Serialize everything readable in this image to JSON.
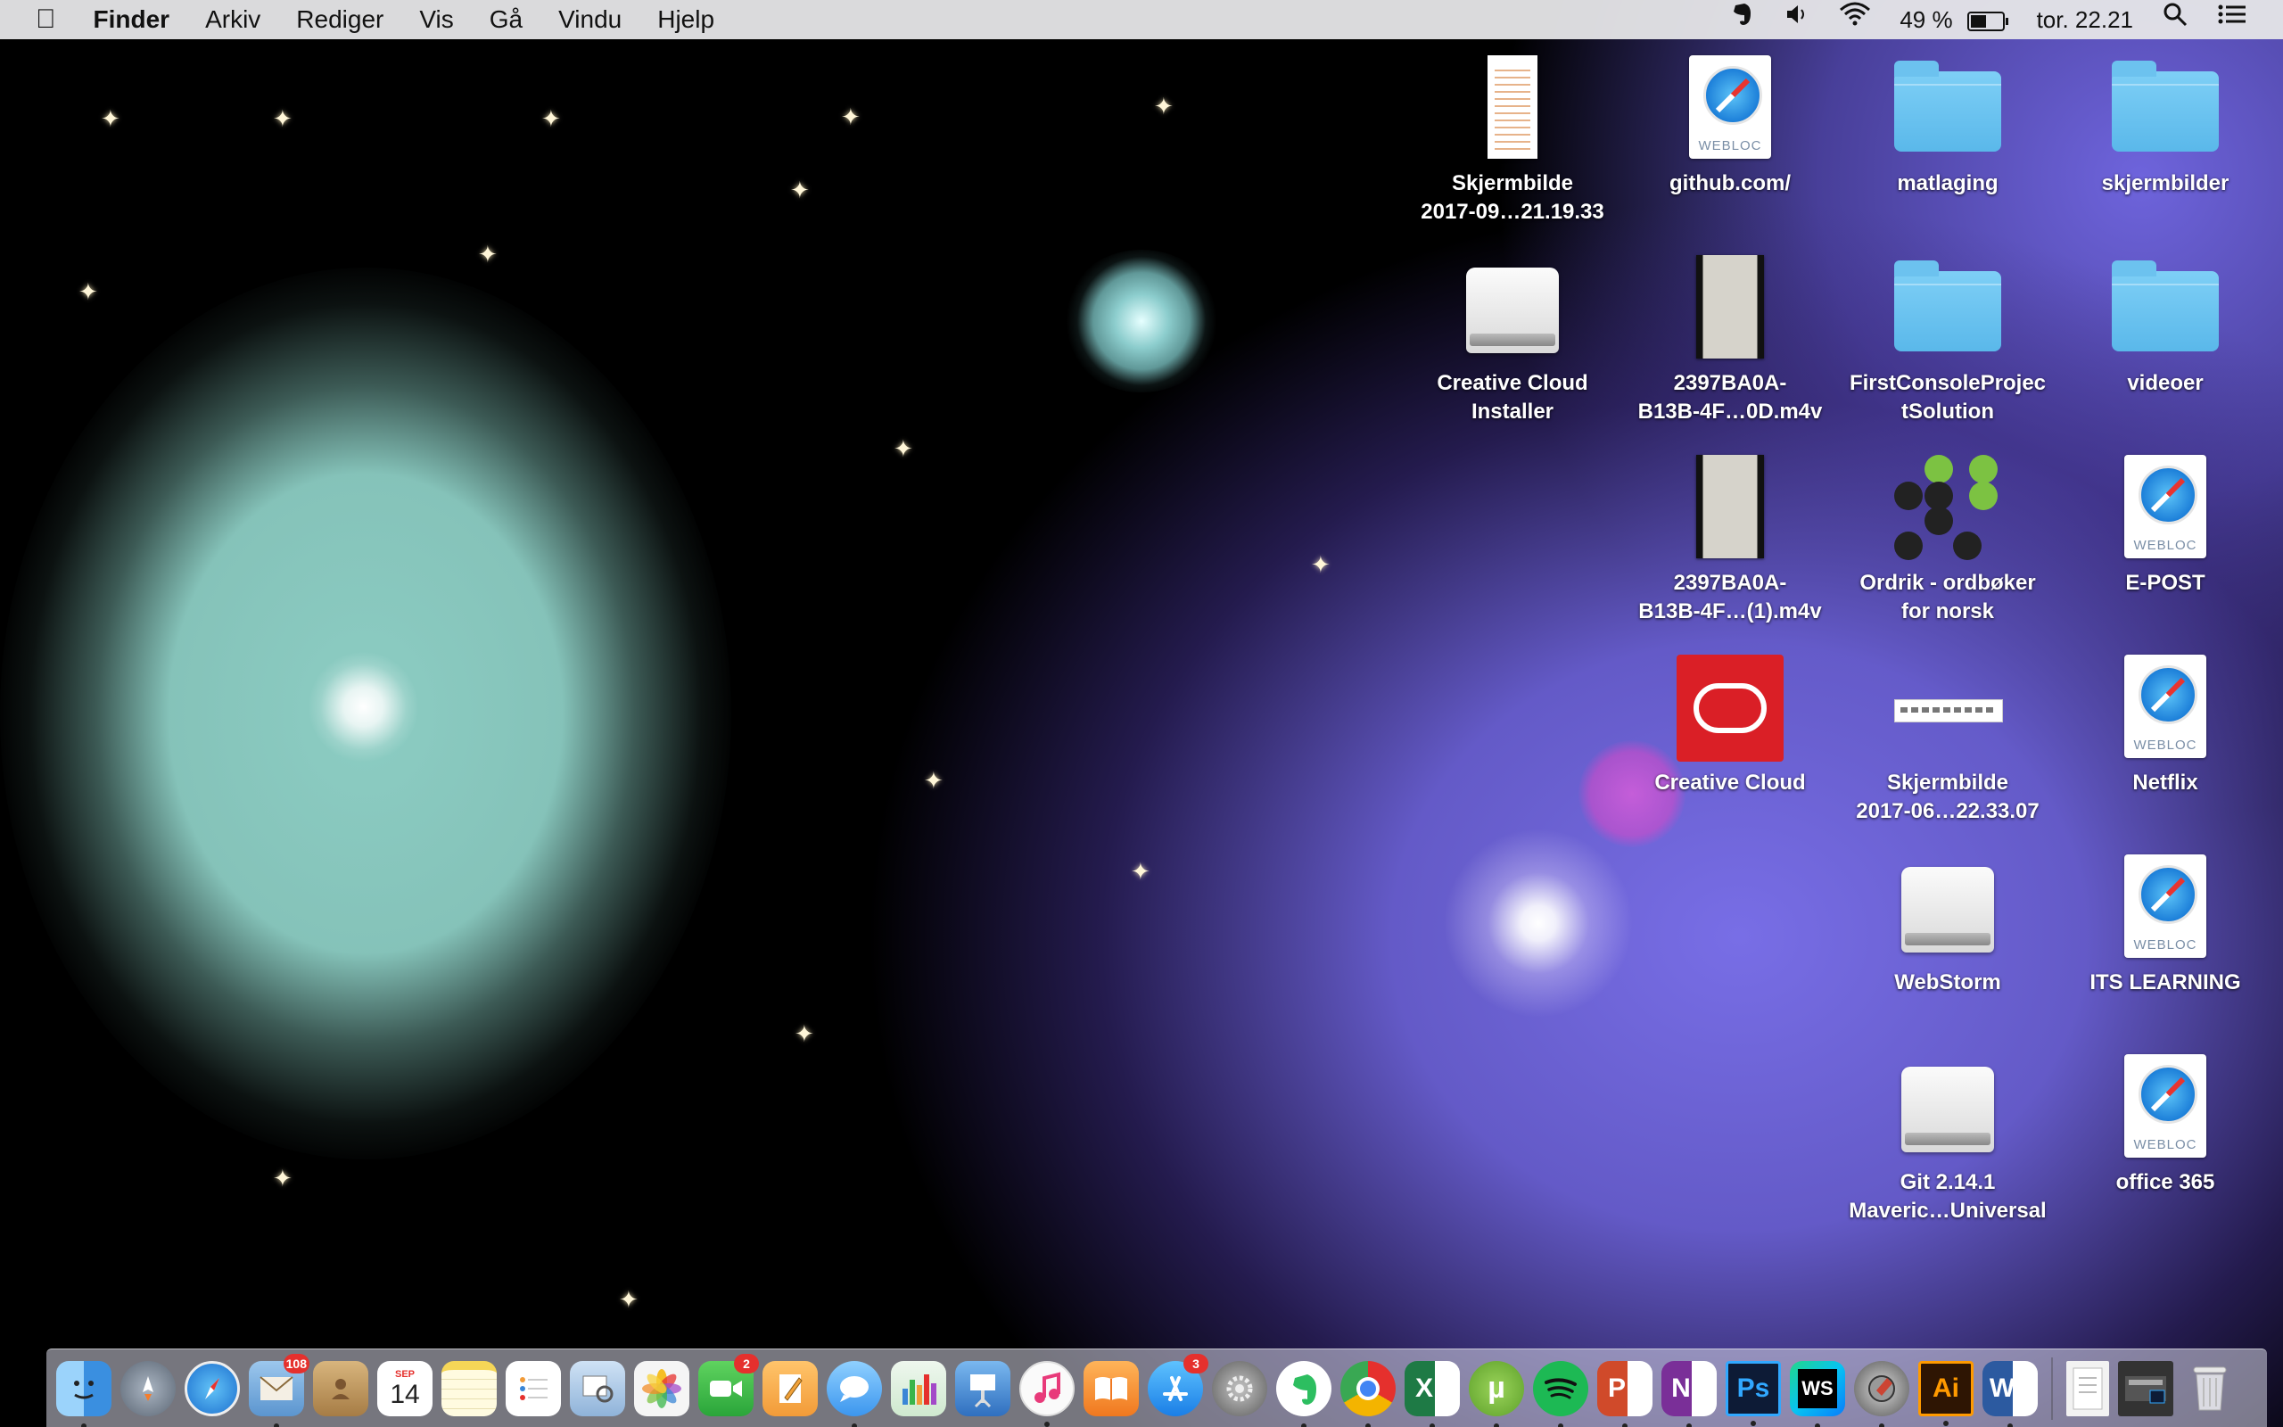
{
  "menubar": {
    "apple_icon": "apple-logo",
    "app_name": "Finder",
    "menus": [
      "Arkiv",
      "Rediger",
      "Vis",
      "Gå",
      "Vindu",
      "Hjelp"
    ],
    "status": {
      "evernote_icon": "evernote-icon",
      "volume_icon": "speaker-icon",
      "wifi_icon": "wifi-icon",
      "battery_percent": "49 %",
      "battery_level": 0.49,
      "clock": "tor. 22.21",
      "spotlight_icon": "search-icon",
      "notification_icon": "list-icon"
    }
  },
  "desktop_icons": [
    {
      "name": "Skjermbilde\n2017-09…21.19.33",
      "kind": "image"
    },
    {
      "name": "github.com/",
      "kind": "webloc"
    },
    {
      "name": "matlaging",
      "kind": "folder"
    },
    {
      "name": "skjermbilder",
      "kind": "folder"
    },
    {
      "name": "Creative Cloud\nInstaller",
      "kind": "drive"
    },
    {
      "name": "2397BA0A-\nB13B-4F…0D.m4v",
      "kind": "video"
    },
    {
      "name": "FirstConsoleProjec\ntSolution",
      "kind": "folder"
    },
    {
      "name": "videoer",
      "kind": "folder"
    },
    {
      "name": "2397BA0A-\nB13B-4F…(1).m4v",
      "kind": "video"
    },
    {
      "name": "Ordrik - ordbøker\nfor norsk",
      "kind": "app"
    },
    {
      "name": "E-POST",
      "kind": "webloc"
    },
    {
      "name": "Creative Cloud",
      "kind": "app"
    },
    {
      "name": "Skjermbilde\n2017-06…22.33.07",
      "kind": "image"
    },
    {
      "name": "Netflix",
      "kind": "webloc"
    },
    {
      "name": "WebStorm",
      "kind": "drive"
    },
    {
      "name": "ITS LEARNING",
      "kind": "webloc"
    },
    {
      "name": "Git 2.14.1\nMaveric…Universal",
      "kind": "drive"
    },
    {
      "name": "office 365",
      "kind": "webloc"
    }
  ],
  "webloc_label": "WEBLOC",
  "dock": {
    "calendar_month": "SEP",
    "calendar_day": "14",
    "mail_badge": "108",
    "facetime_badge": "2",
    "appstore_badge": "3",
    "apps": [
      {
        "icon": "finder-icon",
        "color": "#3a8fe0"
      },
      {
        "icon": "launchpad-icon",
        "color": "#6d7a8a"
      },
      {
        "icon": "safari-icon",
        "color": "#2a7fd8"
      },
      {
        "icon": "mail-icon",
        "color": "#6aa6de"
      },
      {
        "icon": "contacts-icon",
        "color": "#c79e63"
      },
      {
        "icon": "calendar-icon",
        "color": "#ffffff"
      },
      {
        "icon": "notes-icon",
        "color": "#f7e07a"
      },
      {
        "icon": "reminders-icon",
        "color": "#ffffff"
      },
      {
        "icon": "preview-icon",
        "color": "#8fb3d9"
      },
      {
        "icon": "photos-icon",
        "color": "#f2f2f2"
      },
      {
        "icon": "facetime-icon",
        "color": "#39b54a"
      },
      {
        "icon": "pages-icon",
        "color": "#f29b38"
      },
      {
        "icon": "messages-icon",
        "color": "#4aa6f0"
      },
      {
        "icon": "numbers-icon",
        "color": "#3fb24a"
      },
      {
        "icon": "keynote-icon",
        "color": "#3a86d6"
      },
      {
        "icon": "itunes-icon",
        "color": "#f7f7f7"
      },
      {
        "icon": "ibooks-icon",
        "color": "#f28c26"
      },
      {
        "icon": "appstore-icon",
        "color": "#2b93ef"
      },
      {
        "icon": "system-preferences-icon",
        "color": "#888888"
      },
      {
        "icon": "evernote-icon",
        "color": "#2d2d2d"
      },
      {
        "icon": "chrome-icon",
        "color": "#e8e8e8"
      },
      {
        "icon": "excel-icon",
        "color": "#1e7a45"
      },
      {
        "icon": "utorrent-icon",
        "color": "#78bb3b"
      },
      {
        "icon": "spotify-icon",
        "color": "#1db954"
      },
      {
        "icon": "powerpoint-icon",
        "color": "#d04a2a"
      },
      {
        "icon": "onenote-icon",
        "color": "#7a2f98"
      },
      {
        "icon": "photoshop-icon",
        "color": "#0d1b36"
      },
      {
        "icon": "webstorm-icon",
        "color": "#111111"
      },
      {
        "icon": "disk-utility-icon",
        "color": "#444444"
      },
      {
        "icon": "illustrator-icon",
        "color": "#2e1503"
      },
      {
        "icon": "word-icon",
        "color": "#2c5aa0"
      }
    ],
    "stack_items": [
      {
        "icon": "document-stack-icon",
        "color": "#efefef"
      },
      {
        "icon": "downloads-stack-icon",
        "color": "#333333"
      },
      {
        "icon": "trash-icon",
        "color": "#dcdcdc"
      }
    ]
  }
}
